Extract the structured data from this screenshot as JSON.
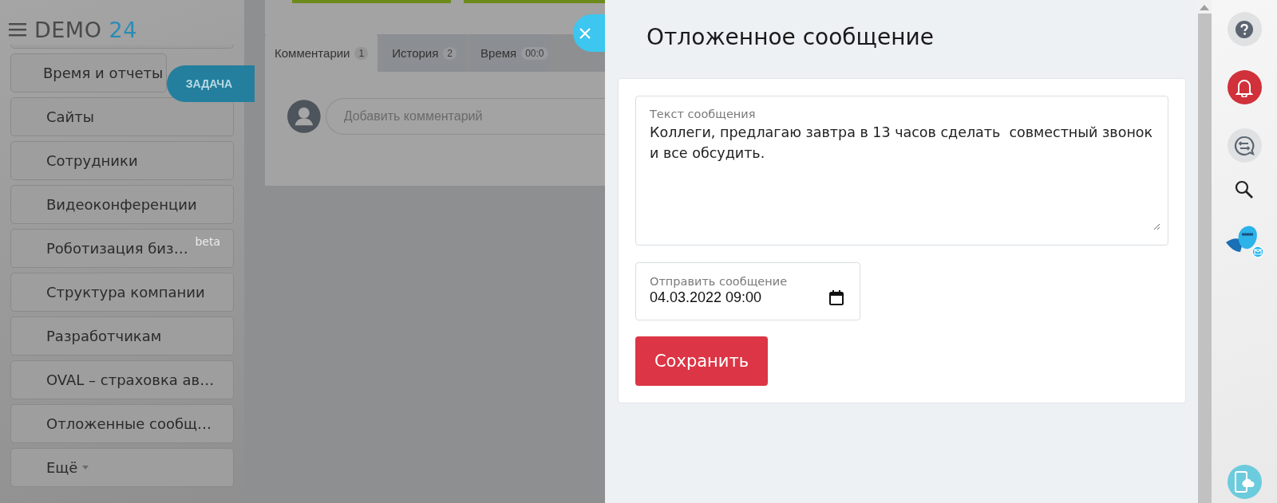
{
  "header": {
    "logo_text": "DEMO",
    "logo_number": "24"
  },
  "sidebar": {
    "items": [
      {
        "label": "Время и отчеты"
      },
      {
        "label": "Сайты"
      },
      {
        "label": "Сотрудники"
      },
      {
        "label": "Видеоконференции"
      },
      {
        "label": "Роботизация биз…",
        "badge": "beta"
      },
      {
        "label": "Структура компании"
      },
      {
        "label": "Разработчикам"
      },
      {
        "label": "OVAL – страховка ав…"
      },
      {
        "label": "Отложенные сообщ…"
      },
      {
        "label": "Ещё",
        "has_menu": true
      }
    ]
  },
  "task_label": "ЗАДАЧА",
  "task": {
    "tabs": [
      {
        "label": "Комментарии",
        "count": "1",
        "selected": true
      },
      {
        "label": "История",
        "count": "2",
        "selected": false
      },
      {
        "label": "Время",
        "count": "00:0",
        "selected": false
      }
    ],
    "comment": {
      "placeholder": "Добавить комментарий"
    }
  },
  "panel": {
    "title": "Отложенное сообщение",
    "message": {
      "label": "Текст сообщения",
      "value": "Коллеги, предлагаю завтра в 13 часов сделать  совместный звонок и все обсудить."
    },
    "send_at": {
      "label": "Отправить сообщение",
      "value": "04.03.2022 09:00"
    },
    "save_button": "Сохранить"
  }
}
